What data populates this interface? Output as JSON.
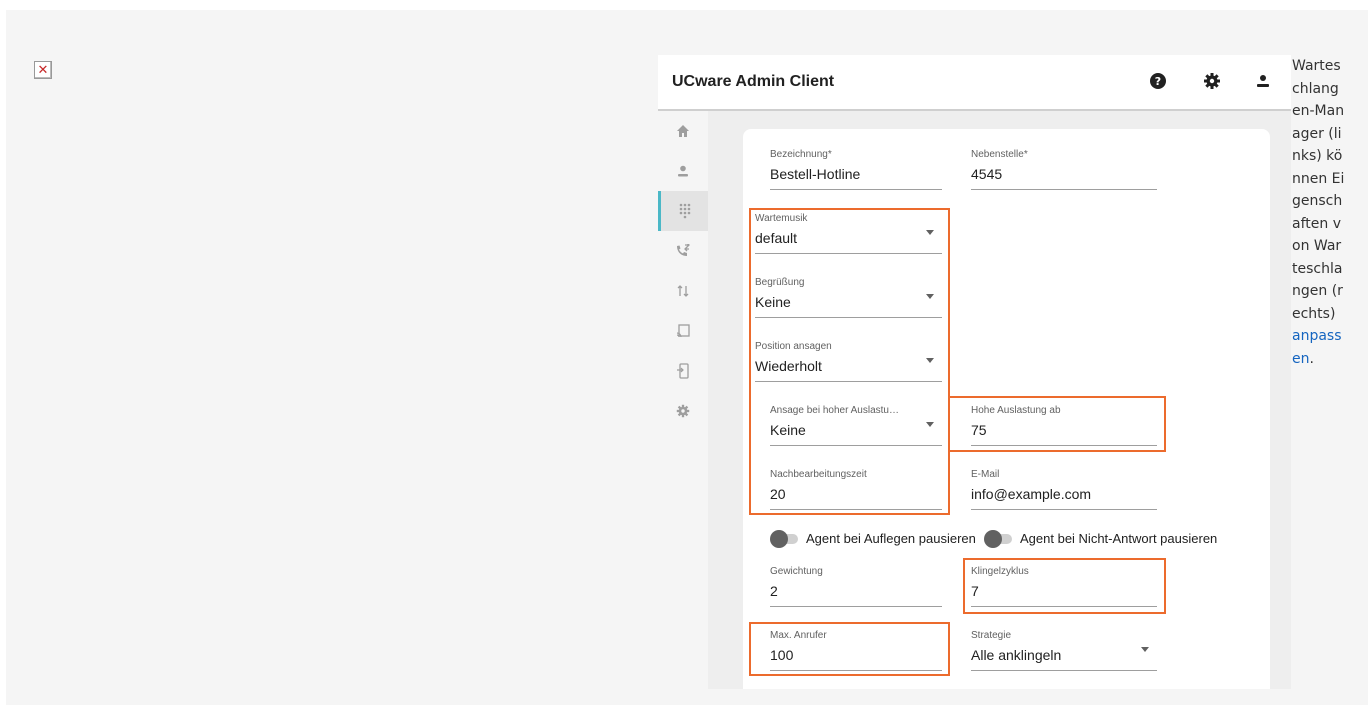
{
  "app": {
    "title": "UCware Admin Client"
  },
  "sidebar": {
    "items": [
      {
        "icon": "home-icon"
      },
      {
        "icon": "user-icon"
      },
      {
        "icon": "dialpad-icon",
        "active": true
      },
      {
        "icon": "call-forward-icon"
      },
      {
        "icon": "swap-vert-icon"
      },
      {
        "icon": "cast-icon"
      },
      {
        "icon": "phone-device-icon"
      },
      {
        "icon": "gear-icon"
      }
    ],
    "expand_label": "→"
  },
  "form": {
    "bezeichnung": {
      "label": "Bezeichnung*",
      "value": "Bestell-Hotline"
    },
    "nebenstelle": {
      "label": "Nebenstelle*",
      "value": "4545"
    },
    "wartemusik": {
      "label": "Wartemusik",
      "value": "default"
    },
    "begruessung": {
      "label": "Begrüßung",
      "value": "Keine"
    },
    "position": {
      "label": "Position ansagen",
      "value": "Wiederholt"
    },
    "ansage_hoch": {
      "label": "Ansage bei hoher Auslastu…",
      "value": "Keine"
    },
    "hohe_auslastung": {
      "label": "Hohe Auslastung ab",
      "value": "75"
    },
    "nachbearbeitung": {
      "label": "Nachbearbeitungszeit",
      "value": "20"
    },
    "email": {
      "label": "E-Mail",
      "value": "info@example.com"
    },
    "toggle_auflegen": {
      "label": "Agent bei Auflegen pausieren"
    },
    "toggle_nicht_antwort": {
      "label": "Agent bei Nicht-Antwort pausieren"
    },
    "gewichtung": {
      "label": "Gewichtung",
      "value": "2"
    },
    "klingelzyklus": {
      "label": "Klingelzyklus",
      "value": "7"
    },
    "max_anrufer": {
      "label": "Max. Anrufer",
      "value": "100"
    },
    "strategie": {
      "label": "Strategie",
      "value": "Alle anklingeln"
    }
  },
  "caption": {
    "text": "Warteschlangen-Manager (links) können Eigenschaften von Warteschlangen (rechts) ",
    "link": "anpassen",
    "end": "."
  },
  "colors": {
    "highlight": "#ec6b2d",
    "accent": "#4bb8c7",
    "link": "#1565c0"
  }
}
